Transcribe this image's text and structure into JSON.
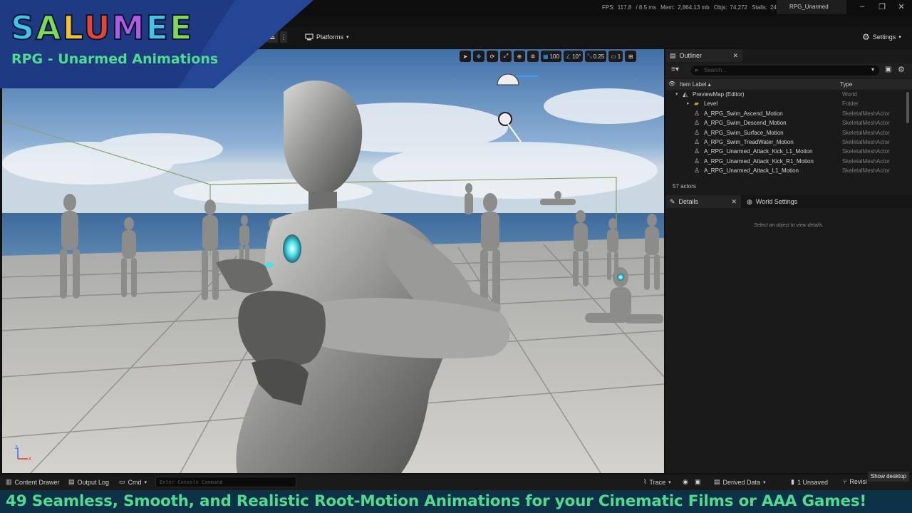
{
  "brand": {
    "title_letters": [
      {
        "ch": "S",
        "color": "#3cc7e8"
      },
      {
        "ch": "A",
        "color": "#7ed957"
      },
      {
        "ch": "L",
        "color": "#f2c12e"
      },
      {
        "ch": "U",
        "color": "#e8442e"
      },
      {
        "ch": "M",
        "color": "#b05ce0"
      },
      {
        "ch": "E",
        "color": "#3cc7e8"
      },
      {
        "ch": "E",
        "color": "#7ed957"
      }
    ],
    "subtitle": "RPG - Unarmed Animations"
  },
  "titlebar": {
    "fps_label": "FPS:",
    "fps": "117.8",
    "ms": "/ 8.5 ms",
    "mem_label": "Mem:",
    "mem": "2,864.13 mb",
    "objs_label": "Objs:",
    "objs": "74,272",
    "stalls_label": "Stalls:",
    "stalls": "24",
    "project_tab": "RPG_Unarmed",
    "minimize": "–",
    "restore": "❐",
    "close": "✕"
  },
  "toolbar": {
    "platforms_label": "Platforms",
    "settings_label": "Settings"
  },
  "viewport": {
    "grid_snap": "100",
    "rotation_snap": "10°",
    "scale_snap": "0.25",
    "camera_speed": "1",
    "axis_x": "x",
    "axis_z": "z"
  },
  "outliner": {
    "tab_label": "Outliner",
    "search_placeholder": "Search...",
    "col_label": "Item Label ▴",
    "col_type": "Type",
    "rows": [
      {
        "label": "PreviewMap (Editor)",
        "type": "World",
        "depth": 1,
        "icon": "world"
      },
      {
        "label": "Level",
        "type": "Folder",
        "depth": 2,
        "icon": "folder"
      },
      {
        "label": "A_RPG_Swim_Ascend_Motion",
        "type": "SkeletalMeshActor",
        "depth": 2,
        "icon": "actor"
      },
      {
        "label": "A_RPG_Swim_Descend_Motion",
        "type": "SkeletalMeshActor",
        "depth": 2,
        "icon": "actor"
      },
      {
        "label": "A_RPG_Swim_Surface_Motion",
        "type": "SkeletalMeshActor",
        "depth": 2,
        "icon": "actor"
      },
      {
        "label": "A_RPG_Swim_TreadWater_Motion",
        "type": "SkeletalMeshActor",
        "depth": 2,
        "icon": "actor"
      },
      {
        "label": "A_RPG_Unarmed_Attack_Kick_L1_Motion",
        "type": "SkeletalMeshActor",
        "depth": 2,
        "icon": "actor"
      },
      {
        "label": "A_RPG_Unarmed_Attack_Kick_R1_Motion",
        "type": "SkeletalMeshActor",
        "depth": 2,
        "icon": "actor"
      },
      {
        "label": "A_RPG_Unarmed_Attack_L1_Motion",
        "type": "SkeletalMeshActor",
        "depth": 2,
        "icon": "actor"
      }
    ],
    "actor_count": "57 actors"
  },
  "details": {
    "tab_label": "Details",
    "world_settings_label": "World Settings",
    "empty_message": "Select an object to view details."
  },
  "statusbar": {
    "content_drawer": "Content Drawer",
    "output_log": "Output Log",
    "cmd": "Cmd",
    "console_placeholder": "Enter Console Command",
    "trace": "Trace",
    "derived_data": "Derived Data",
    "unsaved": "1 Unsaved",
    "revision": "Revisi",
    "show_desktop": "Show desktop"
  },
  "caption": {
    "text": "49 Seamless, Smooth, and Realistic Root-Motion Animations for your Cinematic Films or AAA Games!"
  },
  "colors": {
    "accent_green": "#4fdc8f",
    "banner_blue": "#1d3a82",
    "caption_bg": "#0d3146"
  }
}
